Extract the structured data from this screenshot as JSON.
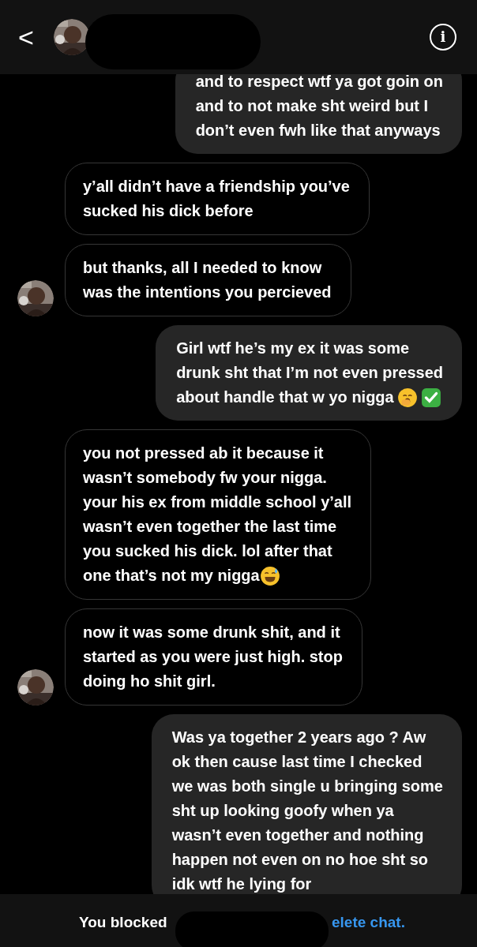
{
  "header": {
    "back": "<",
    "info": "i"
  },
  "messages": [
    {
      "outgoing": true,
      "avatar": false,
      "lines": [
        "and to respect wtf ya got goin on",
        "and to not make sht weird but I",
        "don’t even fwh like that anyways"
      ]
    },
    {
      "outgoing": false,
      "avatar": false,
      "lines": [
        "y’all didn’t have a friendship you’ve",
        "sucked his dick before"
      ]
    },
    {
      "outgoing": false,
      "avatar": true,
      "lines": [
        "but thanks, all I needed to know",
        "was the intentions you percieved"
      ]
    },
    {
      "outgoing": true,
      "avatar": false,
      "lines": [
        "Girl wtf he’s my ex it was some",
        "drunk sht that I’m not even pressed",
        "about handle that w yo nigga"
      ],
      "icons": [
        {
          "kind": "yawn"
        },
        {
          "kind": "check"
        }
      ]
    },
    {
      "outgoing": false,
      "avatar": false,
      "lines": [
        "you not pressed ab it because it",
        "wasn’t somebody fw your nigga.",
        "your his ex from middle school y’all",
        "wasn’t even together the last time",
        "you sucked his dick. lol after that",
        "one that’s not my nigga"
      ],
      "icons": [
        {
          "kind": "sweat"
        }
      ]
    },
    {
      "outgoing": false,
      "avatar": true,
      "lines": [
        "now it was some drunk shit, and it",
        "started as you were just high. stop",
        "doing ho shit girl."
      ]
    },
    {
      "outgoing": true,
      "avatar": false,
      "lines": [
        "Was ya together 2 years ago ? Aw",
        "ok then cause last time I checked",
        "we was both single u bringing some",
        "sht up looking goofy when ya",
        "wasn’t even together and nothing",
        "happen not even on no hoe sht so",
        "idk wtf he lying for"
      ]
    }
  ],
  "footer": {
    "text": "You blocked",
    "link": "elete chat."
  }
}
